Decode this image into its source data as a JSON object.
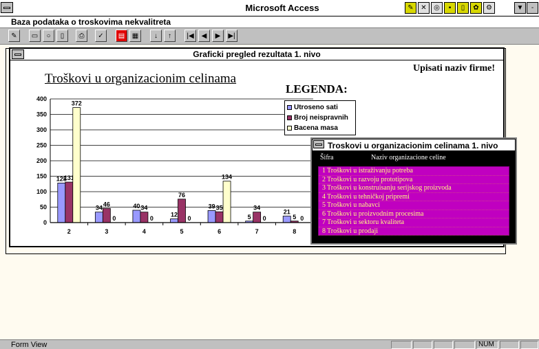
{
  "app": {
    "title": "Microsoft Access"
  },
  "form": {
    "title": "Baza podataka o troskovima nekvalitreta"
  },
  "colors": {
    "series1": "#9999ff",
    "series2": "#993366",
    "series3": "#ffffcc",
    "popup_list": "#c000c0",
    "popup_text": "#ffff80"
  },
  "title_icons": [
    "wizard-icon",
    "palette-icon",
    "zoom-icon",
    "lock-icon",
    "book-icon",
    "tools-icon",
    "settings-icon"
  ],
  "window_buttons": {
    "minimize": "▼",
    "restore": "-"
  },
  "toolbar": {
    "icons": [
      "design-view-icon",
      "print-preview-icon",
      "zoom-icon",
      "page-icon",
      "print-icon",
      "find-icon",
      "form-view-icon",
      "datasheet-icon",
      "sort-asc-icon",
      "sort-desc-icon"
    ],
    "nav": [
      "|◀",
      "◀",
      "▶",
      "▶|"
    ]
  },
  "chart_window": {
    "title": "Graficki pregled rezultata 1. nivo",
    "firm": "Upisati naziv firme!",
    "chart_title": "Troškovi u organizacionim celinama",
    "legend_title": "LEGENDA:"
  },
  "chart_data": {
    "type": "bar",
    "title": "Troškovi u organizacionim celinama",
    "categories": [
      "2",
      "3",
      "4",
      "5",
      "6",
      "7",
      "8"
    ],
    "ylim": [
      0,
      400
    ],
    "yticks": [
      0,
      50,
      100,
      150,
      200,
      250,
      300,
      350,
      400
    ],
    "grid": true,
    "legend_position": "top-right",
    "series": [
      {
        "name": "Utroseno sati",
        "values": [
          128,
          34,
          40,
          12,
          39,
          5,
          21
        ]
      },
      {
        "name": "Broj neispravnih",
        "values": [
          131,
          46,
          34,
          76,
          35,
          34,
          5
        ]
      },
      {
        "name": "Bacena masa",
        "values": [
          372,
          0,
          0,
          0,
          134,
          0,
          0
        ]
      }
    ],
    "labels": [
      [
        "128",
        "34",
        "40",
        "12",
        "39",
        "5",
        "21"
      ],
      [
        "131",
        "46",
        "34",
        "76",
        "35",
        "34",
        "5"
      ],
      [
        "372",
        "0",
        "0",
        "0",
        "134",
        "0",
        "0"
      ]
    ]
  },
  "popup": {
    "title": "Troskovi u organizacionim celinama 1. nivo",
    "col1": "Šifra",
    "col2": "Naziv organizacione celine",
    "items": [
      {
        "id": "1",
        "name": "Troškovi u istraživanju potreba"
      },
      {
        "id": "2",
        "name": "Troškovi u razvoju prototipova"
      },
      {
        "id": "3",
        "name": "Troškovi u konstruisanju serijskog proizvoda"
      },
      {
        "id": "4",
        "name": "Troškovi u tehničkoj pripremi"
      },
      {
        "id": "5",
        "name": "Troškovi u nabavci"
      },
      {
        "id": "6",
        "name": "Troškovi u proizvodnim procesima"
      },
      {
        "id": "7",
        "name": "Troškovi u sektoru kvaliteta"
      },
      {
        "id": "8",
        "name": "Troškovi u prodaji"
      }
    ]
  },
  "status": {
    "text": "Form View",
    "num": "NUM"
  }
}
